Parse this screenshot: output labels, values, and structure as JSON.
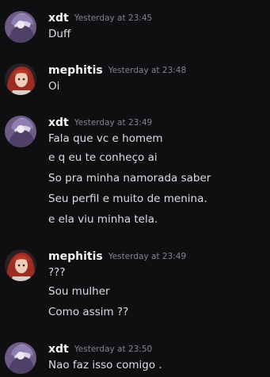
{
  "messages": [
    {
      "author": "xdt",
      "avatar": "xdt-avatar",
      "timestamp": "Yesterday at 23:45",
      "lines": [
        "Duff"
      ]
    },
    {
      "author": "mephitis",
      "avatar": "mephitis-avatar",
      "timestamp": "Yesterday at 23:48",
      "lines": [
        "Oi"
      ]
    },
    {
      "author": "xdt",
      "avatar": "xdt-avatar",
      "timestamp": "Yesterday at 23:49",
      "lines": [
        "Fala que vc e homem",
        "e q eu te conheço ai",
        "So pra minha namorada saber",
        "Seu perfil e muito de menina.",
        "e ela viu minha tela."
      ]
    },
    {
      "author": "mephitis",
      "avatar": "mephitis-avatar",
      "timestamp": "Yesterday at 23:49",
      "lines": [
        "???",
        "Sou mulher",
        "Como assim ??"
      ]
    },
    {
      "author": "xdt",
      "avatar": "xdt-avatar",
      "timestamp": "Yesterday at 23:50",
      "lines": [
        "Nao faz isso comigo ."
      ]
    }
  ],
  "colors": {
    "background": "#0f0f12",
    "username": "#f2f3f5",
    "timestamp": "#80848e",
    "message_text": "#dbdee1"
  }
}
